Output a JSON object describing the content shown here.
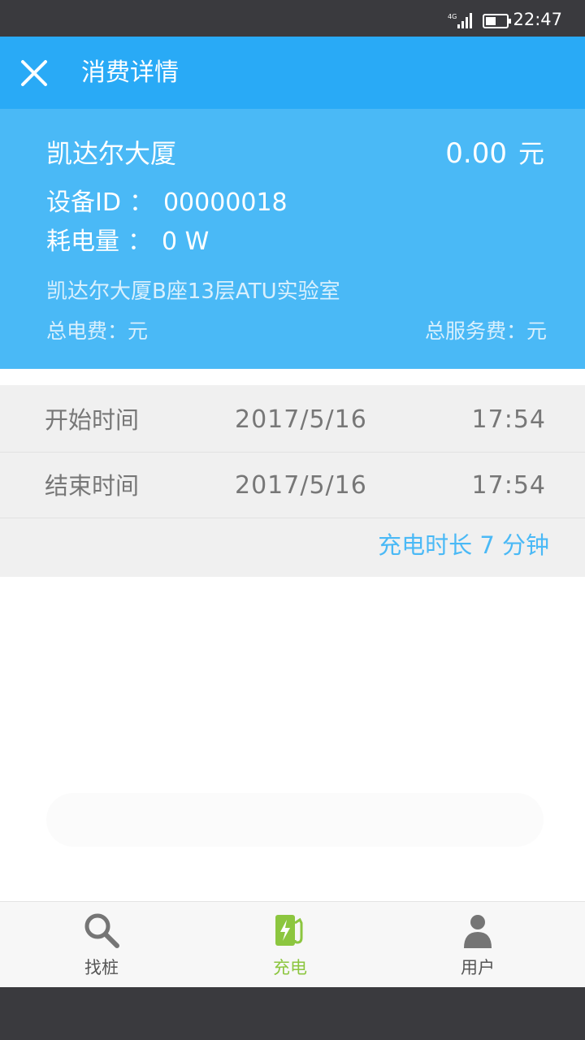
{
  "status_bar": {
    "network": "4G",
    "time": "22:47"
  },
  "header": {
    "title": "消费详情",
    "close_icon": "close-icon"
  },
  "summary": {
    "station_name": "凯达尔大厦",
    "amount": "0.00",
    "amount_unit": "元",
    "device_label": "设备ID",
    "device_sep": "：",
    "device_id": "00000018",
    "power_label": "耗电量",
    "power_sep": "：",
    "power_value": "0 W",
    "address": "凯达尔大厦B座13层ATU实验室",
    "total_electric_fee": "总电费：元",
    "total_service_fee": "总服务费：元"
  },
  "times": {
    "start": {
      "label": "开始时间",
      "date": "2017/5/16",
      "time": "17:54"
    },
    "end": {
      "label": "结束时间",
      "date": "2017/5/16",
      "time": "17:54"
    },
    "duration": "充电时长 7 分钟"
  },
  "tabs": [
    {
      "label": "找桩",
      "icon": "search-icon"
    },
    {
      "label": "充电",
      "icon": "charging-station-icon",
      "active": true
    },
    {
      "label": "用户",
      "icon": "user-icon"
    }
  ],
  "colors": {
    "primary": "#29aaf6",
    "summary_bg": "#4ab9f6",
    "active_tab": "#8cc63f",
    "status_bar": "#3a3a3e"
  }
}
